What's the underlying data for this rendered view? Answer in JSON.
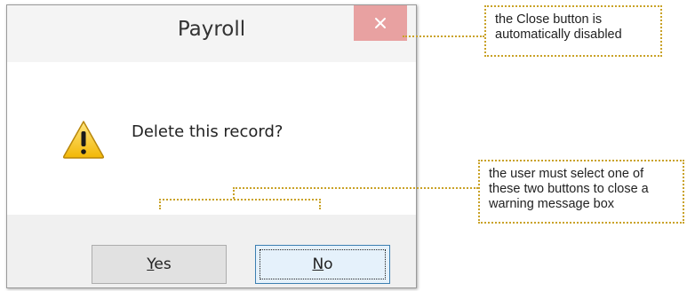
{
  "dialog": {
    "title": "Payroll",
    "close_icon": "close-icon",
    "close_color": "#e8a1a1",
    "message": "Delete this record?",
    "message_icon": "warning-icon",
    "buttons": {
      "yes_label": "Yes",
      "no_label": "No"
    }
  },
  "callouts": {
    "close_note": "the Close button is automatically disabled",
    "buttons_note": "the user must select one of these two buttons to close a warning message box",
    "accent_color": "#c9a227"
  }
}
